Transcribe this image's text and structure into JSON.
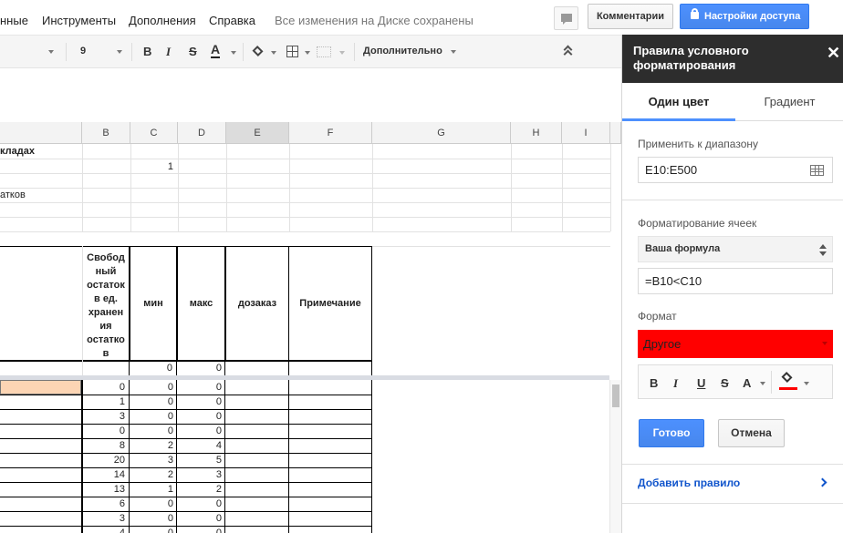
{
  "menu": {
    "items": [
      "нные",
      "Инструменты",
      "Дополнения",
      "Справка"
    ],
    "saved_status": "Все изменения на Диске сохранены"
  },
  "header": {
    "comments_label": "Комментарии",
    "share_label": "Настройки доступа"
  },
  "toolbar": {
    "font_size": "9",
    "bold": "B",
    "italic": "I",
    "strike": "S",
    "text_color": "A",
    "more_label": "Дополнительно"
  },
  "grid": {
    "columns": [
      "B",
      "C",
      "D",
      "E",
      "F",
      "G",
      "H",
      "I"
    ],
    "selected_column": "E",
    "title_fragment": "кладах",
    "c_row2": "1",
    "a_row4": "атков",
    "header_b": "Свобод ный остаток в ед. хранен ия остатко в",
    "header_c": "мин",
    "header_d": "макс",
    "header_e": "дозаказ",
    "header_f": "Примечание",
    "top_row": [
      "",
      "0",
      "0"
    ],
    "rows": [
      [
        "0",
        "0",
        "0"
      ],
      [
        "1",
        "0",
        "0"
      ],
      [
        "3",
        "0",
        "0"
      ],
      [
        "0",
        "0",
        "0"
      ],
      [
        "8",
        "2",
        "4"
      ],
      [
        "20",
        "3",
        "5"
      ],
      [
        "14",
        "2",
        "3"
      ],
      [
        "13",
        "1",
        "2"
      ],
      [
        "6",
        "0",
        "0"
      ],
      [
        "3",
        "0",
        "0"
      ],
      [
        "4",
        "0",
        "0"
      ]
    ]
  },
  "sidebar": {
    "title": "Правила условного форматирования",
    "tab_single": "Один цвет",
    "tab_gradient": "Градиент",
    "range_label": "Применить к диапазону",
    "range_value": "E10:E500",
    "format_cells_label": "Форматирование ячеек",
    "condition": "Ваша формула",
    "formula": "=B10<C10",
    "format_label": "Формат",
    "format_value": "Другое",
    "format_color": "#ff0000",
    "done_label": "Готово",
    "cancel_label": "Отмена",
    "add_rule_label": "Добавить правило"
  },
  "colors": {
    "accent": "#4d90fe",
    "header_dark": "#2d2d2d",
    "selected_cell": "#fcd5b4",
    "link": "#1155cc"
  }
}
